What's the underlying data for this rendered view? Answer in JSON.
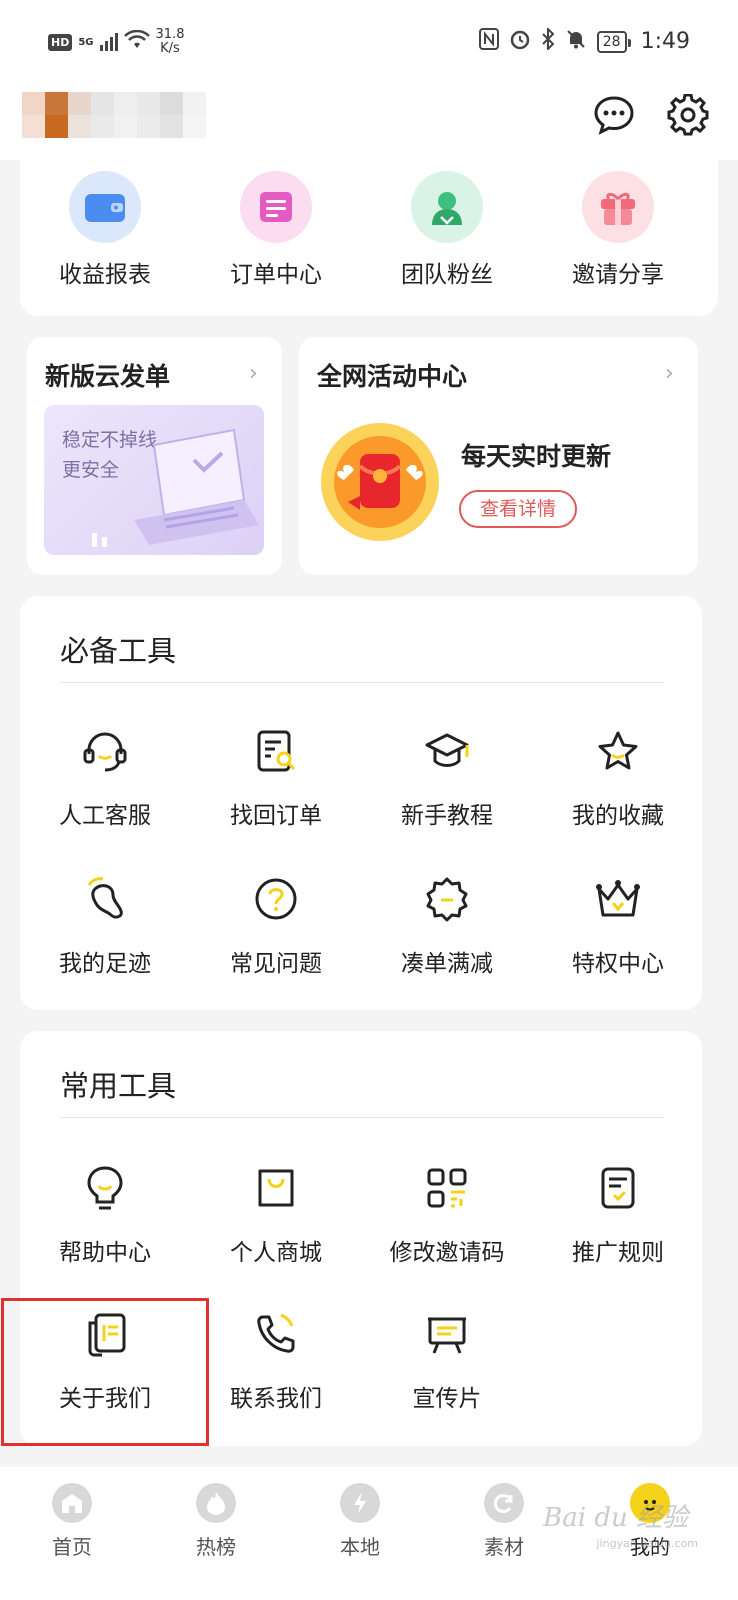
{
  "status_bar": {
    "hd": "HD",
    "signal": "5G",
    "speed_value": "31.8",
    "speed_unit": "K/s",
    "battery": "28",
    "time": "1:49"
  },
  "quick_actions": [
    {
      "label": "收益报表",
      "icon": "wallet-icon",
      "color": "#dbe7fb"
    },
    {
      "label": "订单中心",
      "icon": "order-icon",
      "color": "#fbdcf0"
    },
    {
      "label": "团队粉丝",
      "icon": "team-icon",
      "color": "#d9f3e6"
    },
    {
      "label": "邀请分享",
      "icon": "gift-icon",
      "color": "#fde0e4"
    }
  ],
  "promo_left": {
    "title": "新版云发单",
    "sub1": "稳定不掉线",
    "sub2": "更安全"
  },
  "promo_right": {
    "title": "全网活动中心",
    "headline": "每天实时更新",
    "button": "查看详情"
  },
  "essential_tools": {
    "title": "必备工具",
    "items": [
      {
        "label": "人工客服",
        "icon": "headset-icon"
      },
      {
        "label": "找回订单",
        "icon": "find-order-icon"
      },
      {
        "label": "新手教程",
        "icon": "graduation-cap-icon"
      },
      {
        "label": "我的收藏",
        "icon": "star-icon"
      },
      {
        "label": "我的足迹",
        "icon": "footprint-icon"
      },
      {
        "label": "常见问题",
        "icon": "question-icon"
      },
      {
        "label": "凑单满减",
        "icon": "discount-icon"
      },
      {
        "label": "特权中心",
        "icon": "crown-icon"
      }
    ]
  },
  "common_tools": {
    "title": "常用工具",
    "items": [
      {
        "label": "帮助中心",
        "icon": "lightbulb-icon"
      },
      {
        "label": "个人商城",
        "icon": "shopping-bag-icon"
      },
      {
        "label": "修改邀请码",
        "icon": "qr-code-icon"
      },
      {
        "label": "推广规则",
        "icon": "rules-doc-icon"
      },
      {
        "label": "关于我们",
        "icon": "about-book-icon"
      },
      {
        "label": "联系我们",
        "icon": "phone-icon"
      },
      {
        "label": "宣传片",
        "icon": "easel-icon"
      }
    ]
  },
  "bottom_nav": [
    {
      "label": "首页",
      "icon": "home-icon"
    },
    {
      "label": "热榜",
      "icon": "flame-icon"
    },
    {
      "label": "本地",
      "icon": "lightning-icon"
    },
    {
      "label": "素材",
      "icon": "refresh-icon"
    },
    {
      "label": "我的",
      "icon": "mascot-icon"
    }
  ],
  "watermark": {
    "text": "Bai du 经验",
    "sub": "jingyan.baidu.com"
  },
  "colors": {
    "accent": "#f5d21a",
    "highlight": "#e03030"
  }
}
